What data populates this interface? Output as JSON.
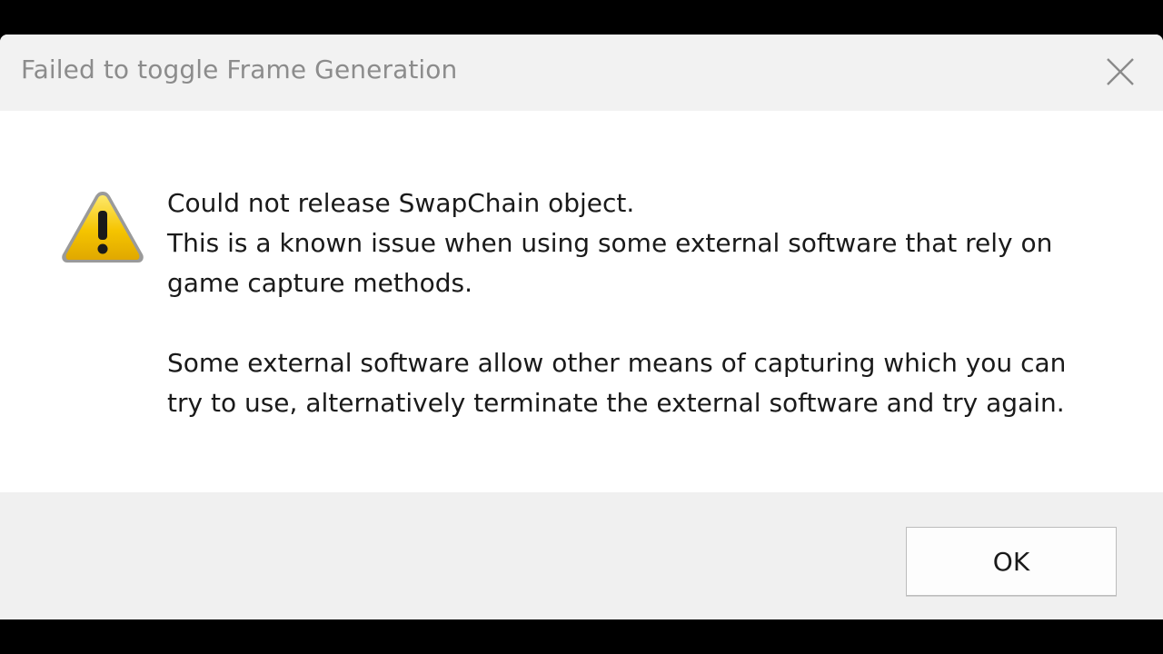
{
  "window": {
    "title": "Failed to toggle Frame Generation",
    "close_icon": "close-icon"
  },
  "message": {
    "icon": "warning-icon",
    "line1": "Could not release SwapChain object.",
    "line2": "This is a known issue when using some external software that rely on",
    "line3": "game capture methods.",
    "line4": "Some external software allow other means of capturing which you can",
    "line5": "try to use, alternatively terminate the external software and try again."
  },
  "footer": {
    "ok_label": "OK"
  },
  "colors": {
    "titlebar_bg": "#f2f2f2",
    "footer_bg": "#f0f0f0",
    "warning_yellow": "#f5c400"
  }
}
